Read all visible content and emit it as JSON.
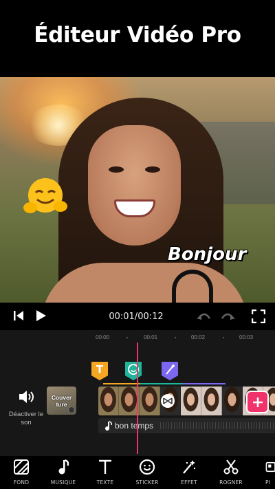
{
  "header": {
    "title": "Éditeur Vidéo Pro"
  },
  "preview": {
    "sticker_text": "Bonjour",
    "emoji_icon": "hugging-face-emoji"
  },
  "player": {
    "time": "00:01/00:12"
  },
  "timeline": {
    "ruler": [
      "00:00",
      "00:01",
      "00:02",
      "00:03"
    ],
    "markers": [
      {
        "label": "T",
        "color": "#f5a623",
        "icon": "text-icon"
      },
      {
        "label": "☺",
        "color": "#1fb59a",
        "icon": "sticker-icon"
      },
      {
        "label": "✦",
        "color": "#7b68ee",
        "icon": "effect-icon"
      }
    ],
    "mute_label": "Déactiver le son",
    "cover_label": "Couver ture",
    "music_name": "bon temps",
    "accent": "#f0346b"
  },
  "toolbar": {
    "items": [
      {
        "label": "FOND",
        "icon": "background-icon"
      },
      {
        "label": "MUSIQUE",
        "icon": "music-icon"
      },
      {
        "label": "TEXTE",
        "icon": "text-icon"
      },
      {
        "label": "STICKER",
        "icon": "sticker-icon"
      },
      {
        "label": "EFFET",
        "icon": "effect-icon"
      },
      {
        "label": "ROGNER",
        "icon": "scissors-icon"
      },
      {
        "label": "PI",
        "icon": "pip-icon"
      }
    ]
  }
}
